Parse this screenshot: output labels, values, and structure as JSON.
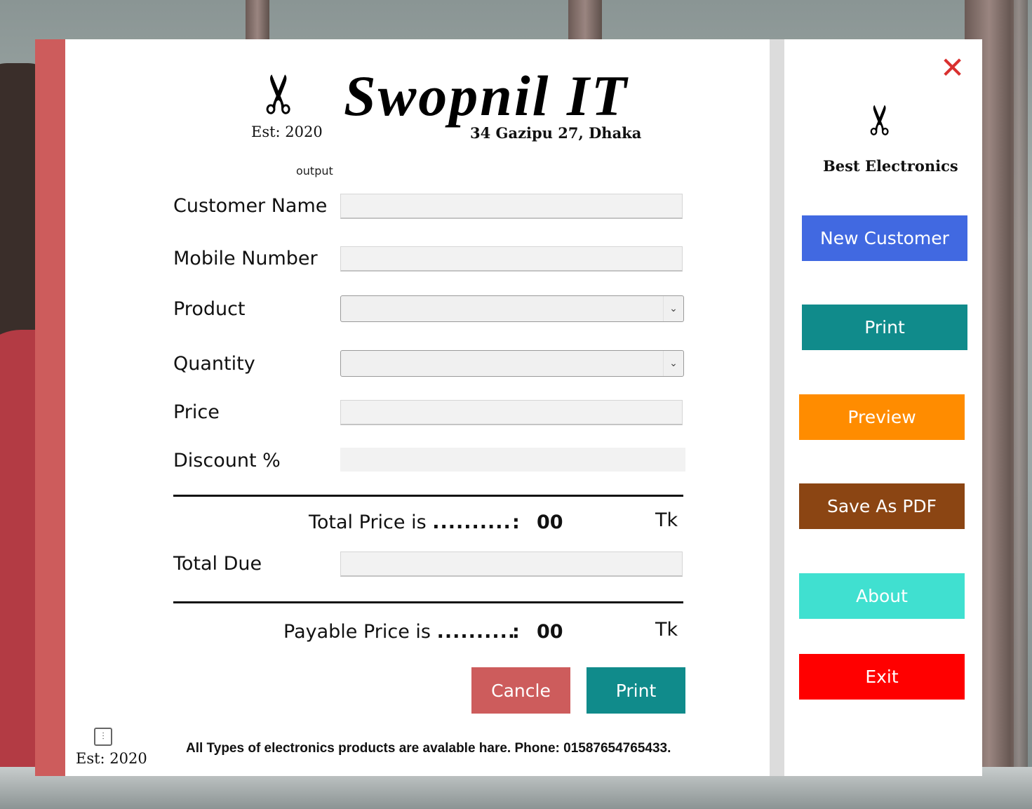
{
  "header": {
    "brand": "Swopnil IT",
    "est": "Est: 2020",
    "address": "34 Gazipu 27, Dhaka",
    "output_label": "output"
  },
  "form": {
    "customer_name_label": "Customer Name",
    "mobile_label": "Mobile Number",
    "product_label": "Product",
    "quantity_label": "Quantity",
    "price_label": "Price",
    "discount_label": "Discount %",
    "total_due_label": "Total Due",
    "customer_name_value": "",
    "mobile_value": "",
    "product_value": "",
    "quantity_value": "",
    "price_value": "",
    "discount_value": "",
    "total_due_value": ""
  },
  "summary": {
    "total_price_label": "Total Price is",
    "payable_price_label": "Payable Price is",
    "dots": "..........",
    "colon": ":",
    "total_price_amount": "00",
    "payable_price_amount": "00",
    "currency": "Tk"
  },
  "actions": {
    "cancel_label": "Cancle",
    "print_label": "Print"
  },
  "footer": {
    "est": "Est: 2020",
    "text": "All Types of electronics products are avalable hare.  Phone: 01587654765433."
  },
  "sidebar": {
    "title": "Best Electronics",
    "close_glyph": "✕",
    "buttons": [
      {
        "label": "New Customer",
        "color": "#4169e1"
      },
      {
        "label": "Print",
        "color": "#108b8b"
      },
      {
        "label": "Preview",
        "color": "#ff8c00"
      },
      {
        "label": "Save As PDF",
        "color": "#8b4513"
      },
      {
        "label": "About",
        "color": "#40e0d0"
      },
      {
        "label": "Exit",
        "color": "#ff0000"
      }
    ]
  },
  "colors": {
    "left_strip": "#cd5c5c",
    "cancel_button": "#cd5c5c",
    "print_button": "#108b8b",
    "close_icon": "#d9302f"
  },
  "icons": {
    "logo": "scissors-icon",
    "sidebar_logo": "scissors-icon",
    "footer": "sliders-icon",
    "close": "close-icon",
    "dropdown": "chevron-down-icon"
  }
}
